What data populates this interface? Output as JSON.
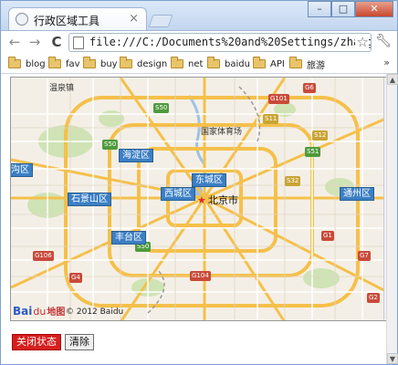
{
  "browser": {
    "tab_title": "行政区域工具",
    "tab_close": "×",
    "url": "file:///C:/Documents%20and%20Settings/zhangying",
    "window_buttons": {
      "minimize": "–",
      "maximize": "□",
      "close": "✕"
    },
    "nav": {
      "back": "←",
      "forward": "→",
      "reload": "C"
    }
  },
  "bookmarks": {
    "items": [
      {
        "label": "blog"
      },
      {
        "label": "fav"
      },
      {
        "label": "buy"
      },
      {
        "label": "design"
      },
      {
        "label": "net"
      },
      {
        "label": "baidu"
      },
      {
        "label": "API"
      },
      {
        "label": "旅游"
      }
    ],
    "more": "»"
  },
  "map": {
    "center_label": "北京市",
    "districts": [
      {
        "label": "海淀区"
      },
      {
        "label": "西城区"
      },
      {
        "label": "东城区"
      },
      {
        "label": "石景山区"
      },
      {
        "label": "丰台区"
      },
      {
        "label": "通州区"
      },
      {
        "label": "沟区"
      }
    ],
    "places": [
      {
        "label": "温泉镇"
      },
      {
        "label": "国家体育场"
      }
    ],
    "roads": [
      "G101",
      "S50",
      "G6",
      "S11",
      "S12",
      "S50",
      "S51",
      "S32",
      "G1",
      "G4",
      "G104",
      "G106",
      "S50",
      "G7",
      "G2"
    ],
    "logo": {
      "bai": "Bai",
      "paw": "du",
      "map": "地图"
    },
    "copyright": "© 2012 Baidu"
  },
  "buttons": {
    "close_status": "关闭状态",
    "clear": "清除"
  },
  "colors": {
    "district_label_bg": "#3b7fc4",
    "close_status_bg": "#d61e1e",
    "map_bg": "#f4efe6",
    "road_major": "#f5c04a"
  }
}
